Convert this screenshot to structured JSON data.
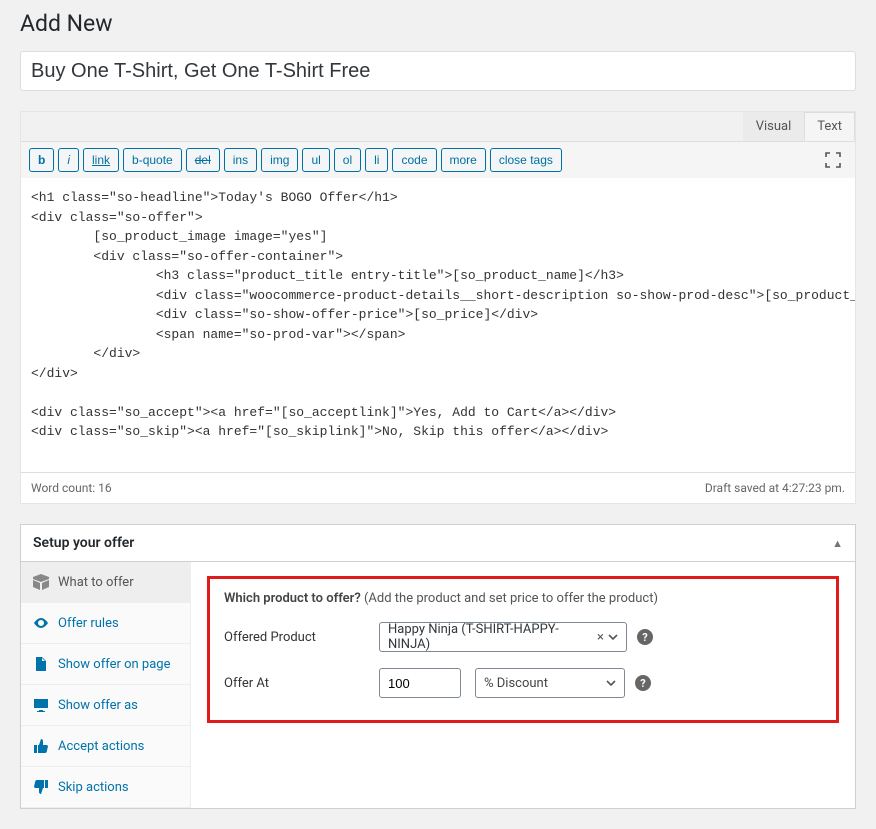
{
  "page_title": "Add New",
  "title_value": "Buy One T-Shirt, Get One T-Shirt Free",
  "editor": {
    "tabs": {
      "visual": "Visual",
      "text": "Text"
    },
    "quicktags": {
      "b": "b",
      "i": "i",
      "link": "link",
      "bquote": "b-quote",
      "del": "del",
      "ins": "ins",
      "img": "img",
      "ul": "ul",
      "ol": "ol",
      "li": "li",
      "code": "code",
      "more": "more",
      "close": "close tags"
    },
    "content": "<h1 class=\"so-headline\">Today's BOGO Offer</h1>\n<div class=\"so-offer\">\n        [so_product_image image=\"yes\"]\n        <div class=\"so-offer-container\">\n                <h3 class=\"product_title entry-title\">[so_product_name]</h3>\n                <div class=\"woocommerce-product-details__short-description so-show-prod-desc\">[so_product_short_description]</div>\n                <div class=\"so-show-offer-price\">[so_price]</div>\n                <span name=\"so-prod-var\"></span>\n        </div>\n</div>\n\n<div class=\"so_accept\"><a href=\"[so_acceptlink]\">Yes, Add to Cart</a></div>\n<div class=\"so_skip\"><a href=\"[so_skiplink]\">No, Skip this offer</a></div>",
    "word_count_label": "Word count: 16",
    "draft_saved": "Draft saved at 4:27:23 pm."
  },
  "offer_box": {
    "title": "Setup your offer",
    "tabs": {
      "what": "What to offer",
      "rules": "Offer rules",
      "page": "Show offer on page",
      "as": "Show offer as",
      "accept": "Accept actions",
      "skip": "Skip actions"
    },
    "content": {
      "question_bold": "Which product to offer?",
      "question_hint": " (Add the product and set price to offer the product)",
      "offered_label": "Offered Product",
      "product_value": "Happy Ninja (T-SHIRT-HAPPY-NINJA)",
      "offer_at_label": "Offer At",
      "offer_at_value": "100",
      "discount_type": "% Discount",
      "help": "?"
    }
  }
}
